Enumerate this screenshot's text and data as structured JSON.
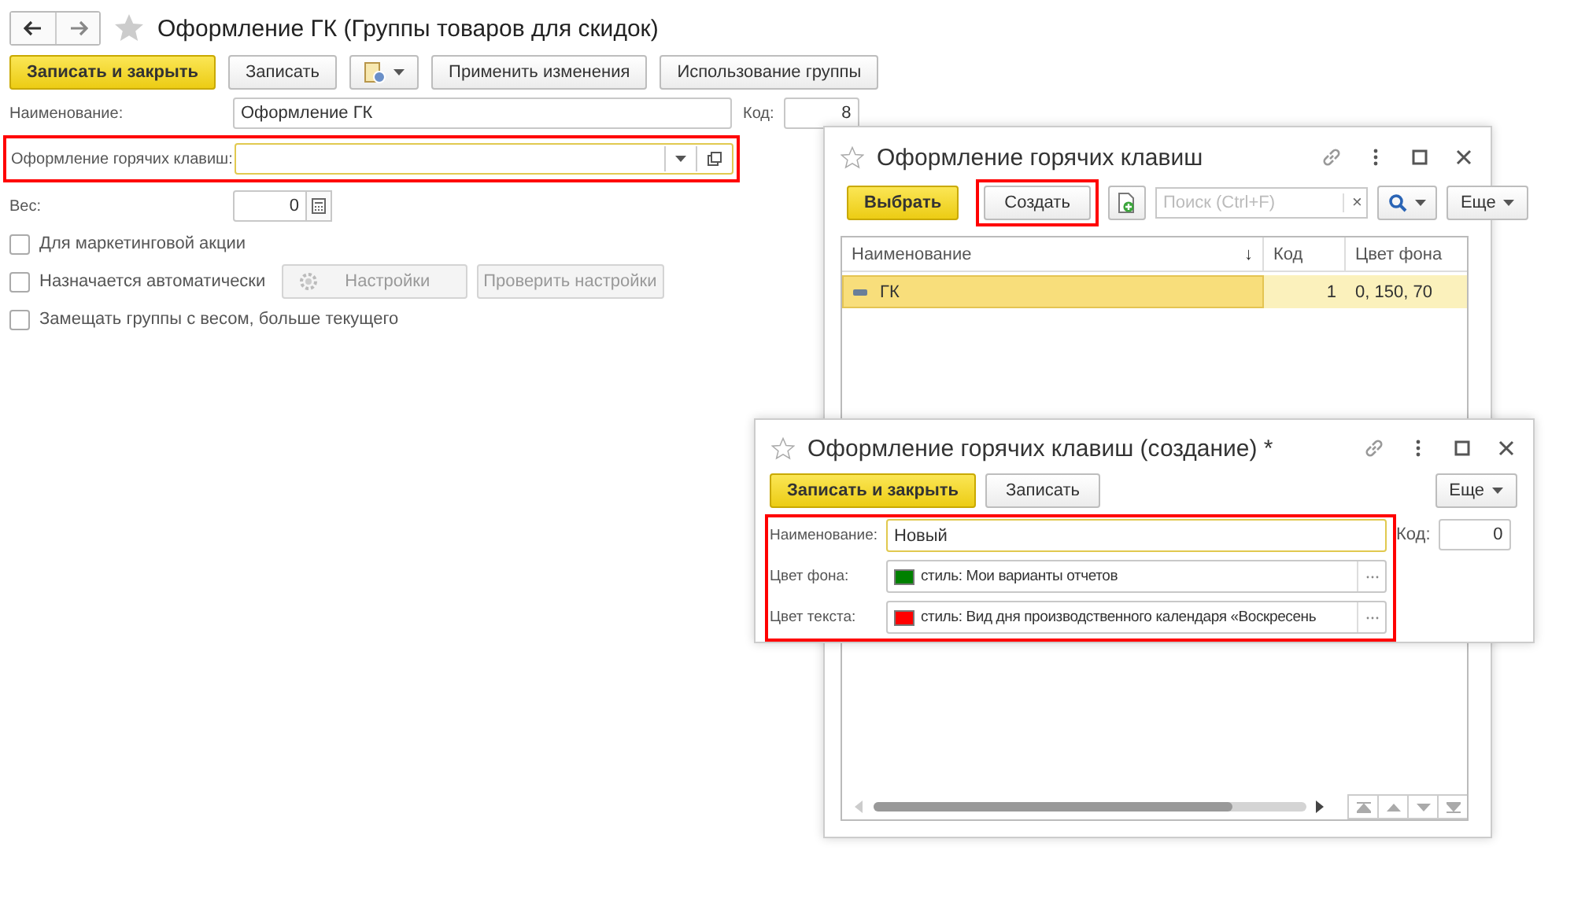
{
  "main_form": {
    "title": "Оформление ГК (Группы товаров для скидок)",
    "buttons": [
      {
        "kind": "primary",
        "label": "Записать и закрыть"
      },
      {
        "kind": "plain",
        "label": "Записать"
      },
      {
        "kind": "report-menu"
      },
      {
        "kind": "plain",
        "label": "Применить изменения"
      },
      {
        "kind": "plain",
        "label": "Использование группы"
      }
    ],
    "name": {
      "label": "Наименование:",
      "value": "Оформление ГК"
    },
    "code": {
      "label": "Код:",
      "value": "8"
    },
    "hotkey": {
      "label": "Оформление горячих клавиш:",
      "highlighted": true
    },
    "weight": {
      "label": "Вес:",
      "value": "0"
    },
    "checkboxes": [
      {
        "label": "Для маркетинговой акции",
        "checked": false
      },
      {
        "label": "Назначается автоматически",
        "checked": false,
        "buttons": [
          {
            "label": "Настройки",
            "disabled": true,
            "icon": true
          },
          {
            "label": "Проверить настройки",
            "disabled": true
          }
        ]
      },
      {
        "label": "Замещать группы с весом, больше текущего",
        "checked": false
      }
    ]
  },
  "list_window": {
    "title": "Оформление горячих клавиш",
    "buttons": [
      {
        "kind": "primary",
        "label": "Выбрать",
        "highlighted": false
      },
      {
        "kind": "plain",
        "label": "Создать",
        "highlighted": true
      }
    ],
    "search": {
      "placeholder": "Поиск (Ctrl+F)",
      "clear": "×"
    },
    "more": "Еще",
    "columns": [
      {
        "label": "Наименование",
        "sort": "↓"
      },
      {
        "label": "Код"
      },
      {
        "label": "Цвет фона"
      }
    ],
    "rows": [
      {
        "cells": [
          "ГК",
          "1",
          "0, 150, 70"
        ],
        "selected": true
      }
    ]
  },
  "create_window": {
    "title": "Оформление горячих клавиш (создание) *",
    "buttons": [
      {
        "kind": "primary",
        "label": "Записать и закрыть"
      },
      {
        "kind": "plain",
        "label": "Записать"
      }
    ],
    "more": "Еще",
    "highlighted": true,
    "fields": [
      {
        "kind": "text",
        "label": "Наименование:",
        "value": "Новый"
      },
      {
        "kind": "color",
        "label": "Цвет фона:",
        "value": "стиль: Мои варианты отчетов",
        "color": "#008000"
      },
      {
        "kind": "color",
        "label": "Цвет текста:",
        "value": "стиль: Вид дня производственного календаря «Воскресень",
        "color": "#ff0000"
      }
    ],
    "code": {
      "label": "Код:",
      "value": "0"
    }
  }
}
